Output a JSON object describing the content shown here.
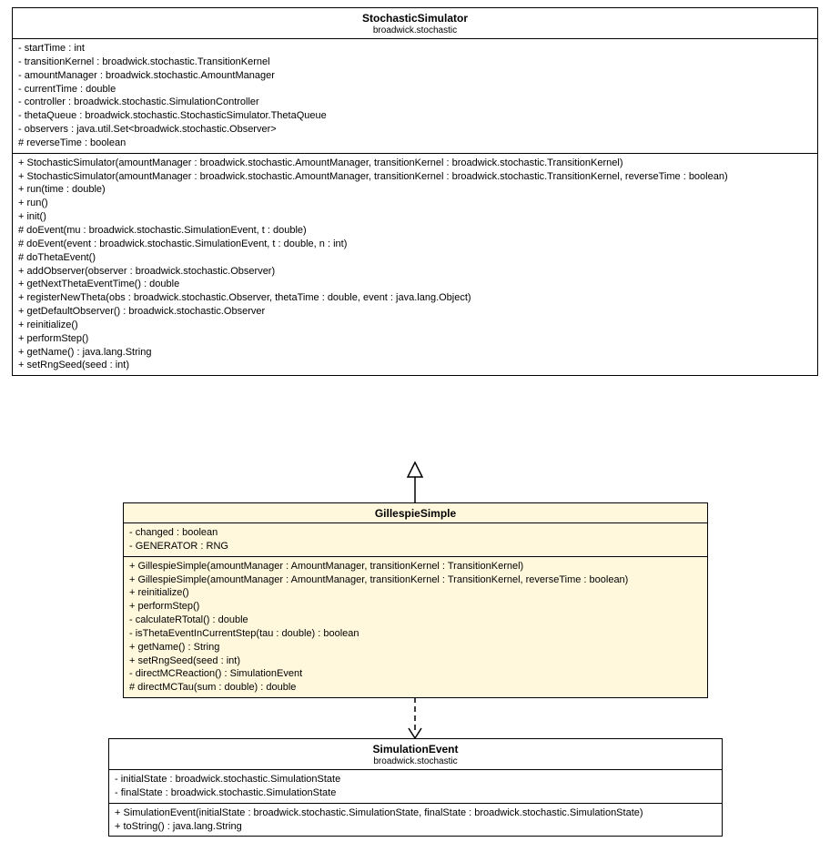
{
  "classes": {
    "stochasticSimulator": {
      "name": "StochasticSimulator",
      "package": "broadwick.stochastic",
      "attributes": [
        "- startTime : int",
        "- transitionKernel : broadwick.stochastic.TransitionKernel",
        "- amountManager : broadwick.stochastic.AmountManager",
        "- currentTime : double",
        "- controller : broadwick.stochastic.SimulationController",
        "- thetaQueue : broadwick.stochastic.StochasticSimulator.ThetaQueue",
        "- observers : java.util.Set<broadwick.stochastic.Observer>",
        "# reverseTime : boolean"
      ],
      "methods": [
        "+ StochasticSimulator(amountManager : broadwick.stochastic.AmountManager, transitionKernel : broadwick.stochastic.TransitionKernel)",
        "+ StochasticSimulator(amountManager : broadwick.stochastic.AmountManager, transitionKernel : broadwick.stochastic.TransitionKernel, reverseTime : boolean)",
        "+ run(time : double)",
        "+ run()",
        "+ init()",
        "# doEvent(mu : broadwick.stochastic.SimulationEvent, t : double)",
        "# doEvent(event : broadwick.stochastic.SimulationEvent, t : double, n : int)",
        "# doThetaEvent()",
        "+ addObserver(observer : broadwick.stochastic.Observer)",
        "+ getNextThetaEventTime() : double",
        "+ registerNewTheta(obs : broadwick.stochastic.Observer, thetaTime : double, event : java.lang.Object)",
        "+ getDefaultObserver() : broadwick.stochastic.Observer",
        "+ reinitialize()",
        "+ performStep()",
        "+ getName() : java.lang.String",
        "+ setRngSeed(seed : int)"
      ]
    },
    "gillespieSimple": {
      "name": "GillespieSimple",
      "package": "",
      "attributes": [
        "- changed : boolean",
        "- GENERATOR : RNG"
      ],
      "methods": [
        "+ GillespieSimple(amountManager : AmountManager, transitionKernel : TransitionKernel)",
        "+ GillespieSimple(amountManager : AmountManager, transitionKernel : TransitionKernel, reverseTime : boolean)",
        "+ reinitialize()",
        "+ performStep()",
        "- calculateRTotal() : double",
        "- isThetaEventInCurrentStep(tau : double) : boolean",
        "+ getName() : String",
        "+ setRngSeed(seed : int)",
        "- directMCReaction() : SimulationEvent",
        "# directMCTau(sum : double) : double"
      ]
    },
    "simulationEvent": {
      "name": "SimulationEvent",
      "package": "broadwick.stochastic",
      "attributes": [
        "- initialState : broadwick.stochastic.SimulationState",
        "- finalState : broadwick.stochastic.SimulationState"
      ],
      "methods": [
        "+ SimulationEvent(initialState : broadwick.stochastic.SimulationState, finalState : broadwick.stochastic.SimulationState)",
        "+ toString() : java.lang.String"
      ]
    }
  }
}
